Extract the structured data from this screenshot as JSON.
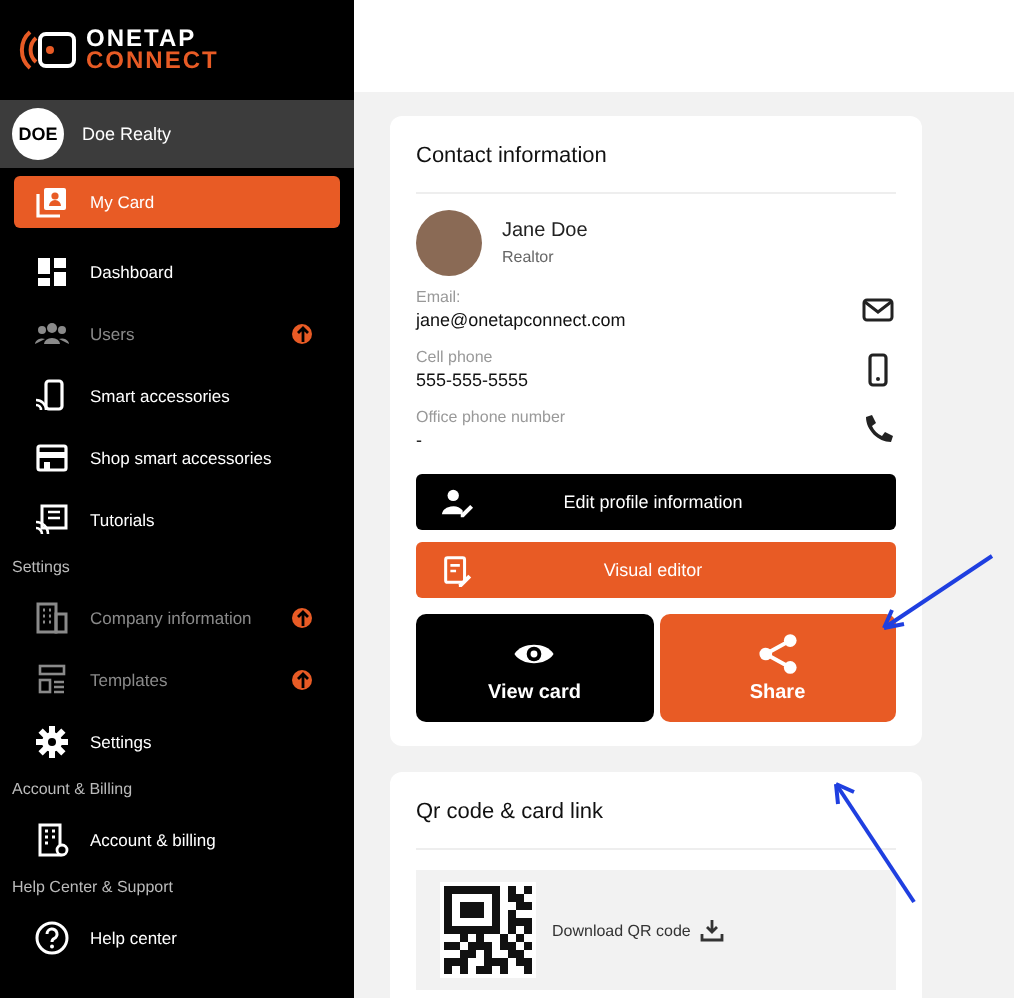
{
  "logo": {
    "line_1": "ONETAP",
    "line_2": "CONNECT"
  },
  "account": {
    "avatar_text": "DOE",
    "name": "Doe Realty"
  },
  "sidebar": {
    "sections": [
      {
        "items": [
          {
            "label": "My Card",
            "selected": true,
            "disabled": false,
            "upgrade": false
          },
          {
            "label": "Dashboard",
            "selected": false,
            "disabled": false,
            "upgrade": false
          },
          {
            "label": "Users",
            "selected": false,
            "disabled": true,
            "upgrade": true
          },
          {
            "label": "Smart accessories",
            "selected": false,
            "disabled": false,
            "upgrade": false
          },
          {
            "label": "Shop smart accessories",
            "selected": false,
            "disabled": false,
            "upgrade": false
          },
          {
            "label": "Tutorials",
            "selected": false,
            "disabled": false,
            "upgrade": false
          }
        ]
      },
      {
        "heading": "Settings",
        "items": [
          {
            "label": "Company information",
            "selected": false,
            "disabled": true,
            "upgrade": true
          },
          {
            "label": "Templates",
            "selected": false,
            "disabled": true,
            "upgrade": true
          },
          {
            "label": "Settings",
            "selected": false,
            "disabled": false,
            "upgrade": false
          }
        ]
      },
      {
        "heading": "Account & Billing",
        "items": [
          {
            "label": "Account & billing",
            "selected": false,
            "disabled": false,
            "upgrade": false
          }
        ]
      },
      {
        "heading": "Help Center & Support",
        "items": [
          {
            "label": "Help center",
            "selected": false,
            "disabled": false,
            "upgrade": false
          }
        ]
      }
    ]
  },
  "contact_card": {
    "title": "Contact information",
    "name": "Jane Doe",
    "role": "Realtor",
    "fields": [
      {
        "label": "Email:",
        "value": "jane@onetapconnect.com"
      },
      {
        "label": "Cell phone",
        "value": "555-555-5555"
      },
      {
        "label": "Office phone number",
        "value": "-"
      }
    ],
    "buttons": [
      {
        "label": "Edit profile information",
        "kind": "dark"
      },
      {
        "label": "Visual editor",
        "kind": "accent"
      }
    ],
    "tiles": [
      {
        "label": "View card",
        "kind": "dark"
      },
      {
        "label": "Share",
        "kind": "accent"
      }
    ]
  },
  "qr_card": {
    "title": "Qr code & card link",
    "download_label": "Download QR code"
  }
}
